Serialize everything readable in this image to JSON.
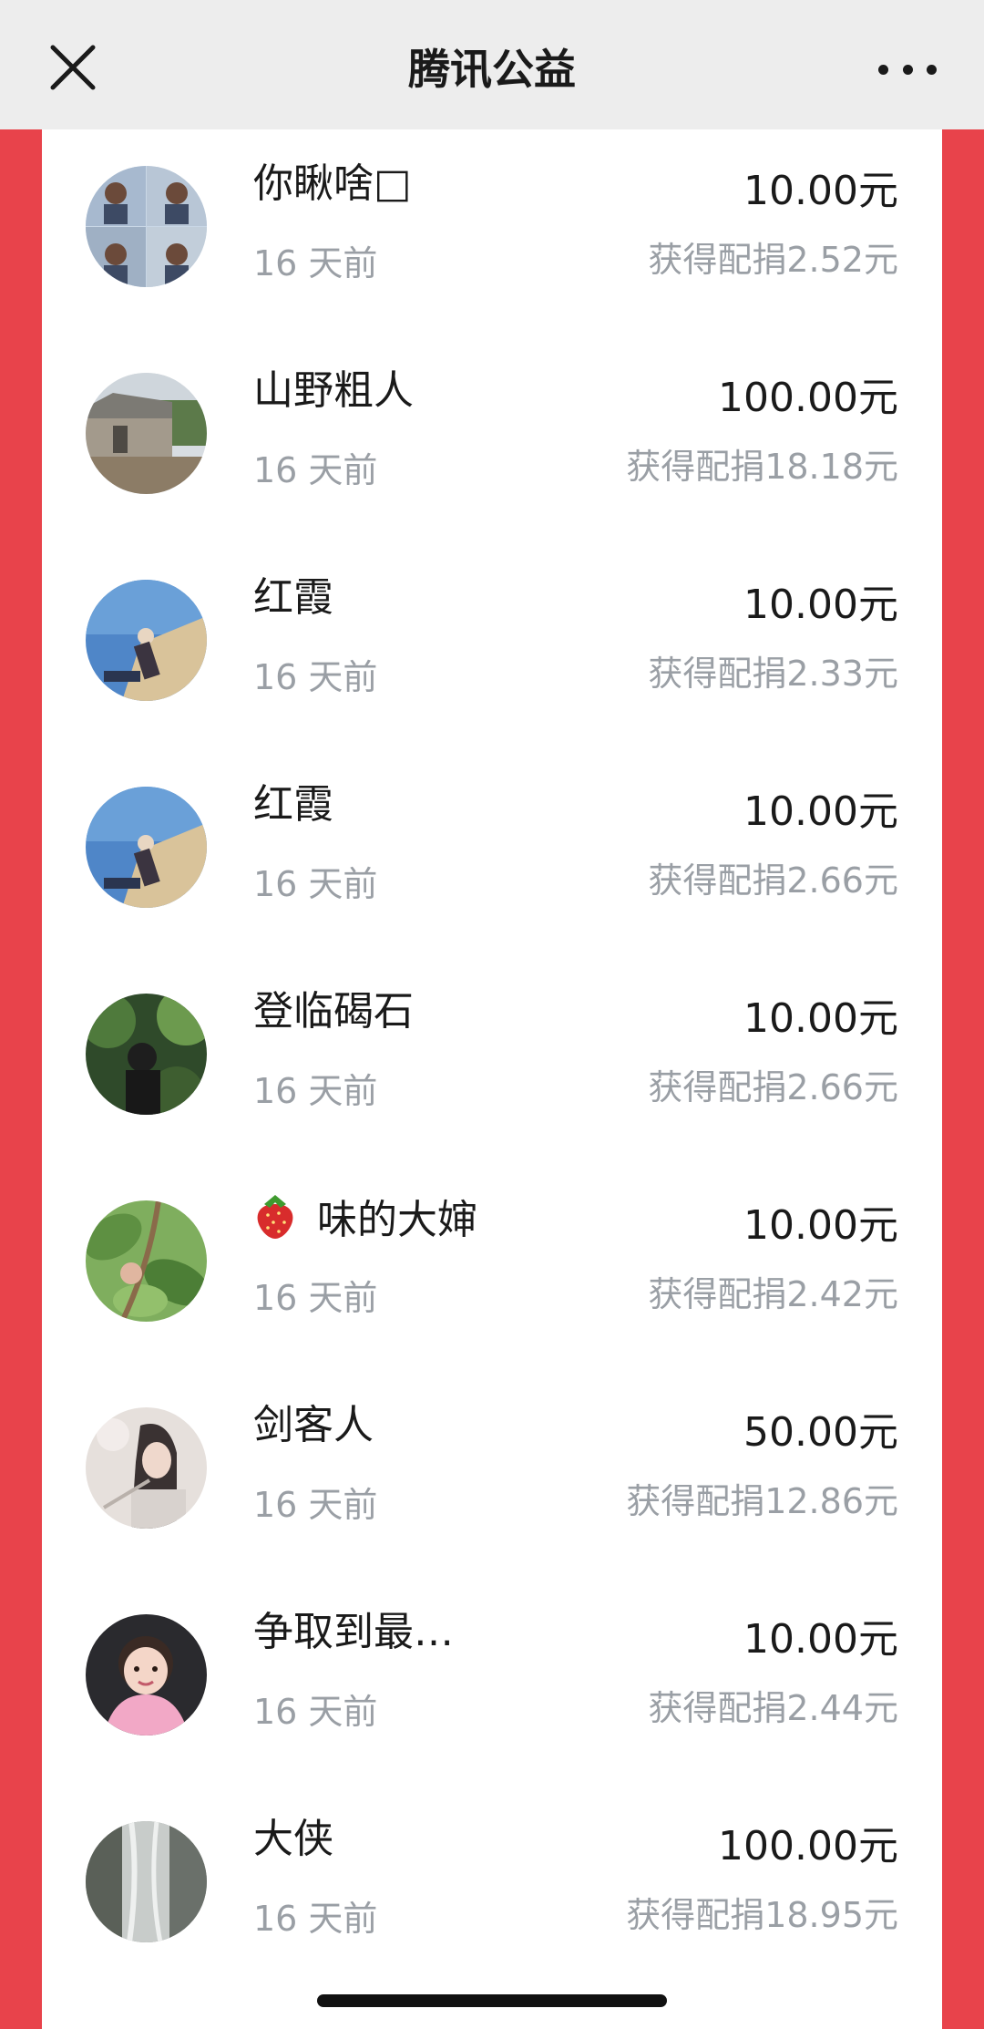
{
  "nav": {
    "title": "腾讯公益"
  },
  "donations": [
    {
      "name": "你瞅啥□",
      "time": "16 天前",
      "amount": "10.00元",
      "match": "获得配捐2.52元",
      "avatar": "avatar-collage-icon"
    },
    {
      "name": "山野粗人",
      "time": "16 天前",
      "amount": "100.00元",
      "match": "获得配捐18.18元",
      "avatar": "avatar-house-icon"
    },
    {
      "name": "红霞",
      "time": "16 天前",
      "amount": "10.00元",
      "match": "获得配捐2.33元",
      "avatar": "avatar-beach-icon"
    },
    {
      "name": "红霞",
      "time": "16 天前",
      "amount": "10.00元",
      "match": "获得配捐2.66元",
      "avatar": "avatar-beach-icon"
    },
    {
      "name": "登临碣石",
      "time": "16 天前",
      "amount": "10.00元",
      "match": "获得配捐2.66元",
      "avatar": "avatar-forest-icon"
    },
    {
      "name": "味的大婶",
      "time": "16 天前",
      "amount": "10.00元",
      "match": "获得配捐2.42元",
      "avatar": "avatar-leaves-icon",
      "prefix_icon": "strawberry-icon"
    },
    {
      "name": "剑客人",
      "time": "16 天前",
      "amount": "50.00元",
      "match": "获得配捐12.86元",
      "avatar": "avatar-swordsman-icon"
    },
    {
      "name": "争取到最…",
      "time": "16 天前",
      "amount": "10.00元",
      "match": "获得配捐2.44元",
      "avatar": "avatar-child-icon"
    },
    {
      "name": "大侠",
      "time": "16 天前",
      "amount": "100.00元",
      "match": "获得配捐18.95元",
      "avatar": "avatar-waterfall-icon"
    }
  ],
  "colors": {
    "side_red": "#e8434b",
    "navbar_bg": "#ededed",
    "secondary_text": "#9a9fa5"
  }
}
